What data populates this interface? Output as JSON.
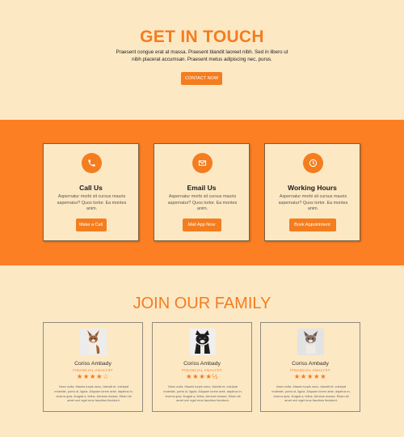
{
  "contact": {
    "title": "GET IN TOUCH",
    "text": "Praesent congue erat at massa. Praesent blandit laoreet nibh. Sed in libero ut nibh placerat accumsan. Praesent metus adipiscing nec, purus.",
    "button": "CONTACT NOW"
  },
  "cards": [
    {
      "icon": "phone-icon",
      "title": "Call Us",
      "text": "Aspernatur morbi sit cursus mauris aspernatur? Quos tortor. Ea montes anim.",
      "button": "Make a Call"
    },
    {
      "icon": "email-icon",
      "title": "Email Us",
      "text": "Aspernatur morbi sit cursus mauris aspernatur? Quos tortor. Ea montes anim.",
      "button": "Mail App Now"
    },
    {
      "icon": "clock-icon",
      "title": "Working Hours",
      "text": "Aspernatur morbi sit cursus mauris aspernatur? Quos tortor. Ea montes anim.",
      "button": "Book Appointment"
    }
  ],
  "family": {
    "title": "JOIN OUR FAMILY",
    "members": [
      {
        "name": "Coriss Ambady",
        "role": "FINANCIAL ANALYST",
        "stars": "★★★★☆",
        "rating": 4,
        "bio": "Nunc nulla. Mauris turpis nunc, blandit et, volutpat molestie, porta ut, ligula. Aliquam lorem ante, dapibus in, viverra quis, feugiat a, tellus. Aenean massa. Etiam sit amet orci eget eros faucibus tincidunt."
      },
      {
        "name": "Coriss Ambady",
        "role": "FINANCIAL ANALYST",
        "stars": "★★★★½",
        "rating": 4.5,
        "bio": "Nunc nulla. Mauris turpis nunc, blandit et, volutpat molestie, porta ut, ligula. Aliquam lorem ante, dapibus in, viverra quis, feugiat a, tellus. Aenean massa. Etiam sit amet orci eget eros faucibus tincidunt."
      },
      {
        "name": "Coriss Ambady",
        "role": "FINANCIAL ANALYST",
        "stars": "★★★★★",
        "rating": 5,
        "bio": "Nunc nulla. Mauris turpis nunc, blandit et, volutpat molestie, porta ut, ligula. Aliquam lorem ante, dapibus in, viverra quis, feugiat a, tellus. Aenean massa. Etiam sit amet orci eget eros faucibus tincidunt."
      }
    ]
  },
  "colors": {
    "accent": "#f47d1f",
    "band": "#fd7f24",
    "background": "#fde8c4"
  }
}
